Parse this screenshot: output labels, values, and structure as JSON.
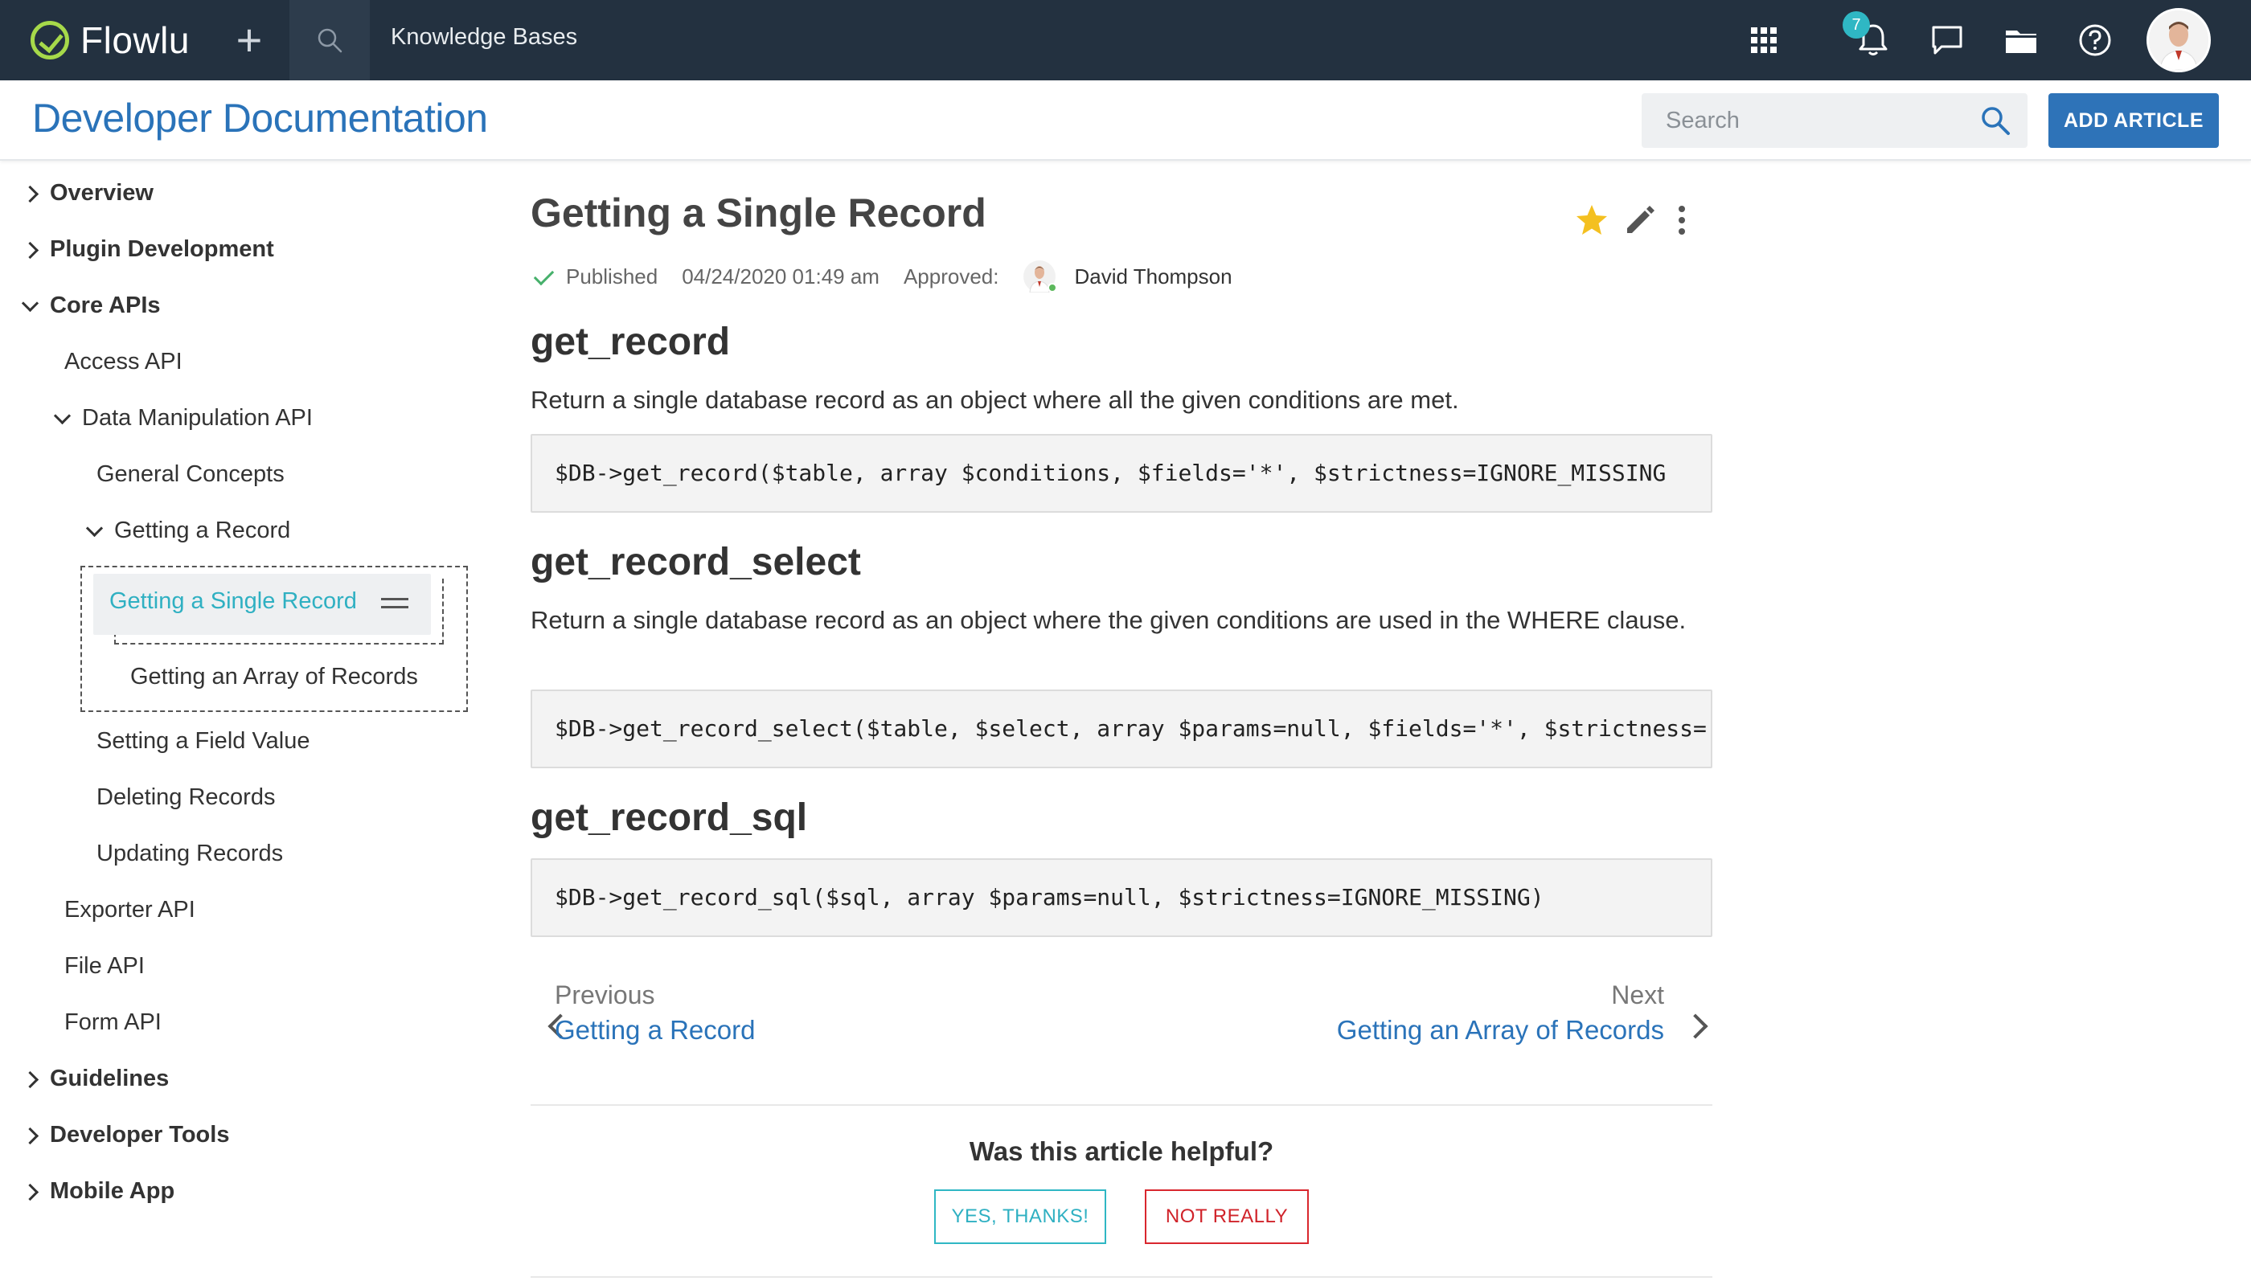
{
  "topbar": {
    "logo_text": "Flowlu",
    "section_label": "Knowledge Bases",
    "notification_count": "7",
    "icons": [
      "plus-icon",
      "search-icon",
      "apps-grid-icon",
      "bell-icon",
      "chat-icon",
      "folder-icon",
      "help-icon"
    ]
  },
  "header": {
    "title": "Developer Documentation",
    "search_placeholder": "Search",
    "add_button": "ADD ARTICLE"
  },
  "sidebar": {
    "overview": "Overview",
    "plugin_development": "Plugin Development",
    "core_apis": "Core APIs",
    "access_api": "Access API",
    "data_manipulation_api": "Data Manipulation API",
    "general_concepts": "General Concepts",
    "getting_a_record": "Getting a Record",
    "getting_single_record": "Getting a Single Record",
    "getting_array_records": "Getting an Array of Records",
    "setting_field_value": "Setting a Field Value",
    "deleting_records": "Deleting Records",
    "updating_records": "Updating Records",
    "exporter_api": "Exporter API",
    "file_api": "File API",
    "form_api": "Form API",
    "guidelines": "Guidelines",
    "developer_tools": "Developer Tools",
    "mobile_app": "Mobile App"
  },
  "article": {
    "title": "Getting a Single Record",
    "status": "Published",
    "date": "04/24/2020 01:49 am",
    "approved_label": "Approved:",
    "approver": "David Thompson",
    "sections": [
      {
        "title": "get_record",
        "description": "Return a single database record as an object where all the given conditions are met.",
        "code": "$DB->get_record($table, array $conditions, $fields='*', $strictness=IGNORE_MISSING"
      },
      {
        "title": "get_record_select",
        "description": "Return a single database record as an object where the given conditions are used in the WHERE clause.",
        "code": "$DB->get_record_select($table, $select, array $params=null, $fields='*', $strictness="
      },
      {
        "title": "get_record_sql",
        "description": "",
        "code": "$DB->get_record_sql($sql, array $params=null, $strictness=IGNORE_MISSING)"
      }
    ],
    "prev_label": "Previous",
    "prev_title": "Getting a Record",
    "next_label": "Next",
    "next_title": "Getting an Array of Records",
    "helpful_question": "Was this article helpful?",
    "yes_button": "YES, THANKS!",
    "no_button": "NOT REALLY"
  },
  "colors": {
    "topbar_bg": "#233140",
    "accent_blue": "#2a73b9",
    "teal": "#2fb7c4",
    "red": "#d9272e",
    "logo_green": "#a6d94a",
    "star": "#f4c020"
  }
}
